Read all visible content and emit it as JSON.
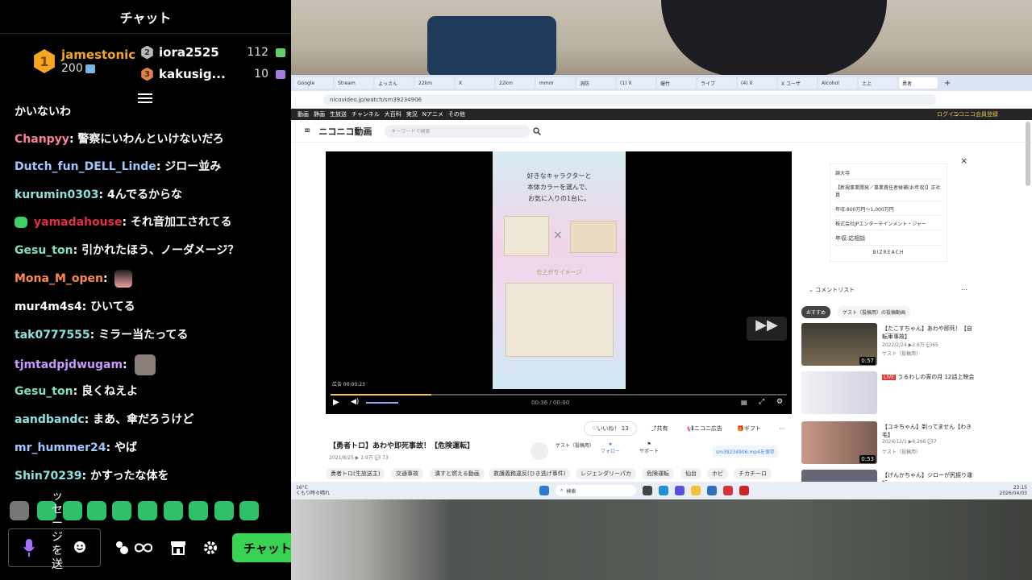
{
  "chat": {
    "header": "チャット",
    "leaderboard": [
      {
        "rank": "1",
        "name": "jamestonic",
        "points": "200"
      },
      {
        "rank": "2",
        "name": "iora2525",
        "points": "112"
      },
      {
        "rank": "3",
        "name": "kakusig...",
        "points": "10"
      }
    ],
    "partial_top": "かいないわ",
    "messages": [
      {
        "user": "Chanpyy",
        "text": "警察にいわんといけないだろ",
        "color": "#ff7f9e"
      },
      {
        "user": "Dutch_fun_DELL_Linde",
        "text": "ジロー並み",
        "color": "#a0c8ff"
      },
      {
        "user": "kurumin0303",
        "text": "4んでるからな",
        "color": "#8ee0e0"
      },
      {
        "user": "yamadahouse",
        "text": "それ音加工されてる",
        "color": "#e0304a"
      },
      {
        "user": "Gesu_ton",
        "text": "引かれたほう、ノーダメージ？",
        "color": "#7fe0c0"
      },
      {
        "user": "Mona_M_open",
        "text": "",
        "color": "#ff8a50"
      },
      {
        "user": "mur4m4s4",
        "text": "ひいてる",
        "color": "#ffffff"
      },
      {
        "user": "tak0777555",
        "text": "ミラー当たってる",
        "color": "#8ee0e0"
      },
      {
        "user": "tjmtadpjdwugam",
        "text": "",
        "color": "#c79bff"
      },
      {
        "user": "Gesu_ton",
        "text": "良くねえよ",
        "color": "#7fe0c0"
      },
      {
        "user": "aandbandc",
        "text": "まあ、傘だろうけど",
        "color": "#8ee0e0"
      },
      {
        "user": "mr_hummer24",
        "text": "やば",
        "color": "#a0c8ff"
      },
      {
        "user": "Shin70239",
        "text": "かすったな体を",
        "color": "#8ee0e0"
      }
    ],
    "input_text": "ッセージを送",
    "send_label": "チャット"
  },
  "browser": {
    "url": "nicovideo.jp/watch/sm39234906",
    "nav_items": [
      "動画",
      "静画",
      "生放送",
      "チャンネル",
      "大百科",
      "実況",
      "Nアニメ",
      "その他"
    ],
    "login": "ログイン",
    "register": "ニコニコ会員登録",
    "logo": "ニコニコ動画",
    "search_placeholder": "キーワードで検索",
    "ad_text": "好きなキャラクターと\n本体カラーを選んで、\nお気に入りの1台に。",
    "ad_sub": "仕上がりイメージ",
    "ad_time": "広告 00:00:23",
    "video_time": "00:36 / 00:00",
    "like": "いいね！ 13",
    "share": "共有",
    "nico_ad": "ニコニ広告",
    "gift": "ギフト",
    "title": "【勇者トロ】あわや即死事故！【危険運転】",
    "meta": "2021/8/25",
    "views": "2.9万",
    "comments": "73",
    "owner": "ゲスト（投稿用）",
    "follow": "フォロー",
    "support": "サポート",
    "save": "sm39234906.mp4を保存",
    "tags": [
      "勇者トロ(生放送主)",
      "交通事故",
      "潰すと燃える動画",
      "救護義務違反(ひき逃げ事件)",
      "レジェンダリーパカ",
      "危険運転",
      "仙台",
      "ホビ",
      "チカチーロ"
    ],
    "side_ad": [
      "論大寺",
      "【新規事業開発／事業責任者候補(お年収)】正社員",
      "年収:800万円〜1,000万円",
      "株式会社JPエンターテインメント・ジャー",
      "年収:応相談",
      "BIZREACH"
    ],
    "comment_list": "コメントリスト",
    "rec_tabs": [
      "おすすめ",
      "ゲスト（投稿用）の投稿動画"
    ],
    "recs": [
      {
        "title": "【たこすちゃん】あわや即死！【自転車事故】",
        "date": "2022/2/24",
        "views": "2.6万",
        "comments": "65",
        "owner": "ゲスト（投稿用）",
        "duration": "0:57"
      },
      {
        "title": "うるわしの宵の月 12話上映会",
        "live": "LIVE"
      },
      {
        "title": "【ユキちゃん】剃ってません【わき毛】",
        "date": "2024/12/1",
        "views": "6,266",
        "comments": "7",
        "owner": "ゲスト（投稿用）",
        "duration": "0:53"
      },
      {
        "title": "【げんかちゃん】ジローが尻振り運転"
      }
    ],
    "taskbar_search": "検索",
    "weather": "16°C",
    "weather_sub": "くもり時々晴れ",
    "clock": "23:15",
    "date": "2026/04/03"
  }
}
